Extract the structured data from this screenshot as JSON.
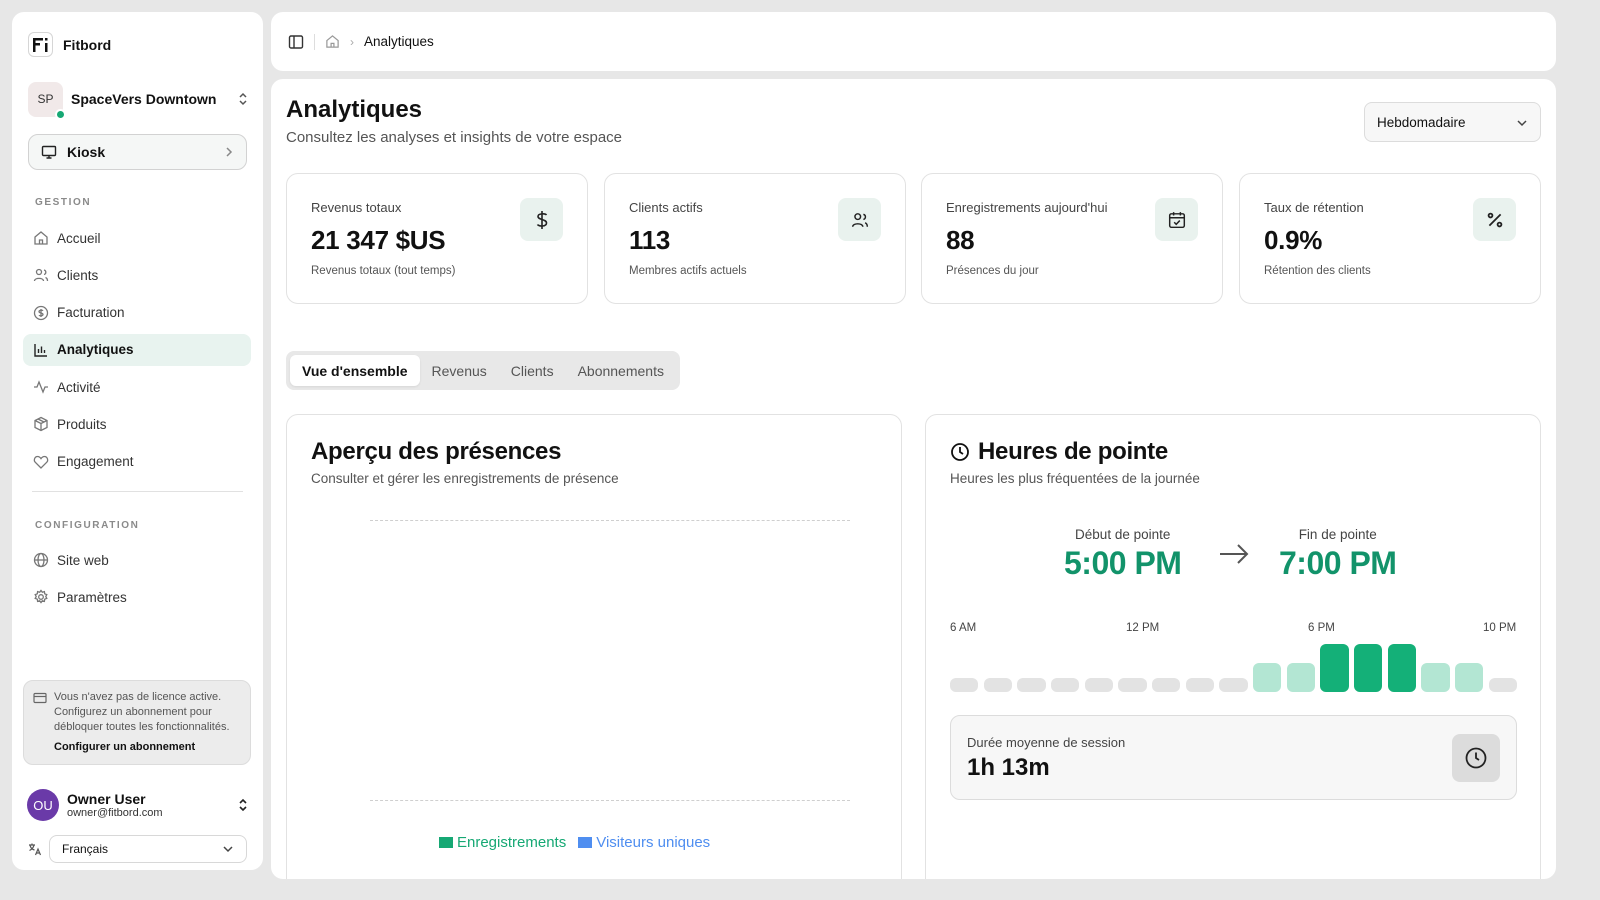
{
  "app": {
    "name": "Fitbord"
  },
  "space": {
    "initials": "SP",
    "name": "SpaceVers Downtown"
  },
  "kiosk": {
    "label": "Kiosk"
  },
  "sidebar": {
    "section_gestion": "GESTION",
    "section_config": "CONFIGURATION",
    "gestion_items": [
      {
        "label": "Accueil",
        "icon": "home-icon"
      },
      {
        "label": "Clients",
        "icon": "users-icon"
      },
      {
        "label": "Facturation",
        "icon": "dollar-circle-icon"
      },
      {
        "label": "Analytiques",
        "icon": "bar-chart-icon",
        "active": true
      },
      {
        "label": "Activité",
        "icon": "activity-icon"
      },
      {
        "label": "Produits",
        "icon": "package-icon"
      },
      {
        "label": "Engagement",
        "icon": "heart-icon"
      }
    ],
    "config_items": [
      {
        "label": "Site web",
        "icon": "globe-icon"
      },
      {
        "label": "Paramètres",
        "icon": "gear-icon"
      }
    ]
  },
  "license": {
    "message": "Vous n'avez pas de licence active. Configurez un abonnement pour débloquer toutes les fonctionnalités.",
    "cta": "Configurer un abonnement"
  },
  "user": {
    "initials": "OU",
    "name": "Owner User",
    "email": "owner@fitbord.com"
  },
  "language": {
    "selected": "Français"
  },
  "breadcrumb": {
    "current": "Analytiques"
  },
  "page": {
    "title": "Analytiques",
    "subtitle": "Consultez les analyses et insights de votre espace",
    "period": "Hebdomadaire"
  },
  "stats": [
    {
      "label": "Revenus totaux",
      "value": "21 347 $US",
      "desc": "Revenus totaux (tout temps)",
      "icon": "dollar-icon"
    },
    {
      "label": "Clients actifs",
      "value": "113",
      "desc": "Membres actifs actuels",
      "icon": "users-icon"
    },
    {
      "label": "Enregistrements aujourd'hui",
      "value": "88",
      "desc": "Présences du jour",
      "icon": "calendar-check-icon"
    },
    {
      "label": "Taux de rétention",
      "value": "0.9%",
      "desc": "Rétention des clients",
      "icon": "percent-icon"
    }
  ],
  "tabs": [
    "Vue d'ensemble",
    "Revenus",
    "Clients",
    "Abonnements"
  ],
  "attendance": {
    "title": "Aperçu des présences",
    "subtitle": "Consulter et gérer les enregistrements de présence",
    "legend": [
      {
        "label": "Enregistrements",
        "color": "#16a874"
      },
      {
        "label": "Visiteurs uniques",
        "color": "#4f8ef0"
      }
    ]
  },
  "peak": {
    "title": "Heures de pointe",
    "subtitle": "Heures les plus fréquentées de la journée",
    "start_label": "Début de pointe",
    "start_value": "5:00 PM",
    "end_label": "Fin de pointe",
    "end_value": "7:00 PM",
    "hour_labels": [
      "6 AM",
      "12 PM",
      "6 PM",
      "10 PM"
    ],
    "hour_levels": [
      0,
      0,
      0,
      0,
      0,
      0,
      0,
      0,
      0,
      1,
      1,
      2,
      2,
      2,
      1,
      1,
      0
    ],
    "session_label": "Durée moyenne de session",
    "session_value": "1h 13m"
  }
}
